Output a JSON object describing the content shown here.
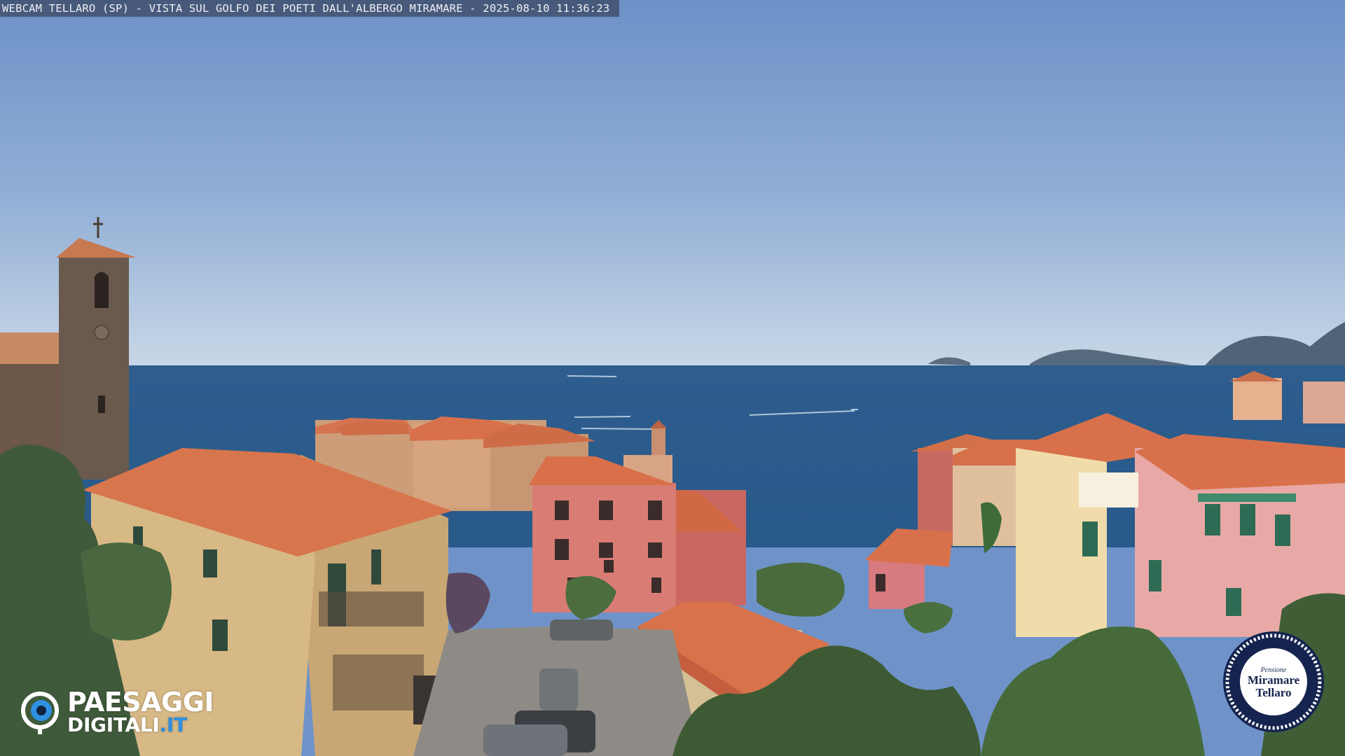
{
  "caption": {
    "text": "WEBCAM TELLARO (SP) - VISTA SUL GOLFO DEI POETI DALL'ALBERGO MIRAMARE - 2025-08-10 11:36:23"
  },
  "logo_left": {
    "word1": "PAESAGGI",
    "word2": "DIGITALI",
    "tld": ".IT",
    "icon": "eye-icon"
  },
  "badge": {
    "small_text": "Pensione",
    "line1": "Miramare",
    "line2": "Tellaro"
  },
  "colors": {
    "sky_top": "#6f93c9",
    "sky_horizon": "#c7d6e6",
    "sea": "#2c5f8f",
    "roof": "#d8714b",
    "badge_navy": "#15244f",
    "logo_blue": "#2f8fe0"
  }
}
